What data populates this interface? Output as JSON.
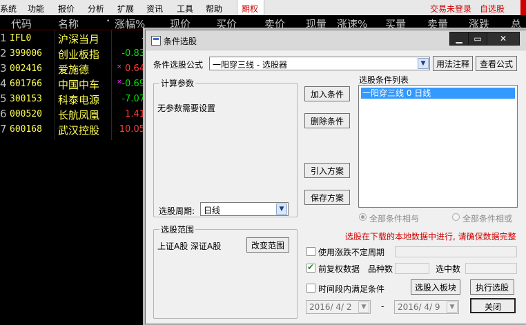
{
  "menubar": {
    "items": [
      "系统",
      "功能",
      "报价",
      "分析",
      "扩展",
      "资讯",
      "工具",
      "帮助"
    ],
    "options": "期权",
    "trade_status": "交易未登录",
    "watchlist": "自选股"
  },
  "table": {
    "headers": [
      "代码",
      "名称",
      "涨幅%",
      "现价",
      "买价",
      "卖价",
      "现量",
      "涨速%",
      "买量",
      "卖量",
      "涨跌",
      "总"
    ],
    "sort_mark": "•",
    "rows": [
      {
        "idx": "1",
        "code": "IFL0",
        "name": "沪深当月",
        "pct": "-",
        "dir": "flat",
        "mark": ""
      },
      {
        "idx": "2",
        "code": "399006",
        "name": "创业板指",
        "pct": "-0.83",
        "dir": "down",
        "mark": ""
      },
      {
        "idx": "3",
        "code": "002416",
        "name": "爱施德",
        "pct": "0.64",
        "dir": "up",
        "mark": "×"
      },
      {
        "idx": "4",
        "code": "601766",
        "name": "中国中车",
        "pct": "-0.69",
        "dir": "down",
        "mark": "×"
      },
      {
        "idx": "5",
        "code": "300153",
        "name": "科泰电源",
        "pct": "-7.07",
        "dir": "down",
        "mark": ""
      },
      {
        "idx": "6",
        "code": "000520",
        "name": "长航凤凰",
        "pct": "1.41",
        "dir": "up",
        "mark": ""
      },
      {
        "idx": "7",
        "code": "600168",
        "name": "武汉控股",
        "pct": "10.05",
        "dir": "up",
        "mark": ""
      }
    ]
  },
  "dialog": {
    "title": "条件选股",
    "window_buttons": {
      "minimize": "▁",
      "maximize": "▭",
      "close": "✕"
    },
    "formula_label": "条件选股公式",
    "formula_value": "一阳穿三线 - 选股器",
    "usage_button": "用法注释",
    "view_formula_button": "查看公式",
    "calc_params_group": "计算参数",
    "no_params_text": "无参数需要设置",
    "period_label": "选股周期:",
    "period_value": "日线",
    "add_condition": "加入条件",
    "delete_condition": "删除条件",
    "import_plan": "引入方案",
    "save_plan": "保存方案",
    "condition_list_label": "选股条件列表",
    "conditions": [
      "一阳穿三线  0  日线"
    ],
    "all_and": "全部条件相与",
    "all_or": "全部条件相或",
    "range_group": "选股范围",
    "range_text": "上证A股  深证A股",
    "change_range": "改变范围",
    "warning": "选股在下载的本地数据中进行, 请确保数据完整",
    "use_variable_period": "使用涨跌不定周期",
    "forward_adjust": "前复权数据",
    "forward_adjust_checked": true,
    "variety_count_label": "品种数",
    "selected_count_label": "选中数",
    "period_condition": "时间段内满足条件",
    "select_to_board": "选股入板块",
    "execute": "执行选股",
    "date_from": "2016/ 4/ 2",
    "date_dash": "-",
    "date_to": "2016/ 4/ 9",
    "close": "关闭"
  }
}
